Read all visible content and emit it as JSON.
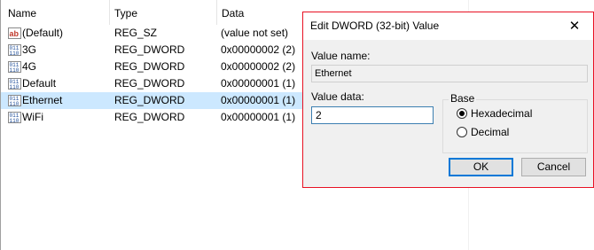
{
  "columns": {
    "name": "Name",
    "type": "Type",
    "data": "Data"
  },
  "rows": [
    {
      "icon": "string-value-icon",
      "name": "(Default)",
      "type": "REG_SZ",
      "data": "(value not set)"
    },
    {
      "icon": "binary-value-icon",
      "name": "3G",
      "type": "REG_DWORD",
      "data": "0x00000002 (2)"
    },
    {
      "icon": "binary-value-icon",
      "name": "4G",
      "type": "REG_DWORD",
      "data": "0x00000002 (2)"
    },
    {
      "icon": "binary-value-icon",
      "name": "Default",
      "type": "REG_DWORD",
      "data": "0x00000001 (1)"
    },
    {
      "icon": "binary-value-icon",
      "name": "Ethernet",
      "type": "REG_DWORD",
      "data": "0x00000001 (1)",
      "selected": true
    },
    {
      "icon": "binary-value-icon",
      "name": "WiFi",
      "type": "REG_DWORD",
      "data": "0x00000001 (1)"
    }
  ],
  "dialog": {
    "title": "Edit DWORD (32-bit) Value",
    "close_icon": "close-icon",
    "value_name_label": "Value name:",
    "value_name": "Ethernet",
    "value_data_label": "Value data:",
    "value_data": "2",
    "base_label": "Base",
    "base_options": [
      "Hexadecimal",
      "Decimal"
    ],
    "base_selected": "Hexadecimal",
    "ok_label": "OK",
    "cancel_label": "Cancel",
    "accent_border_color": "#e81123",
    "selection_color": "#cce8ff"
  }
}
